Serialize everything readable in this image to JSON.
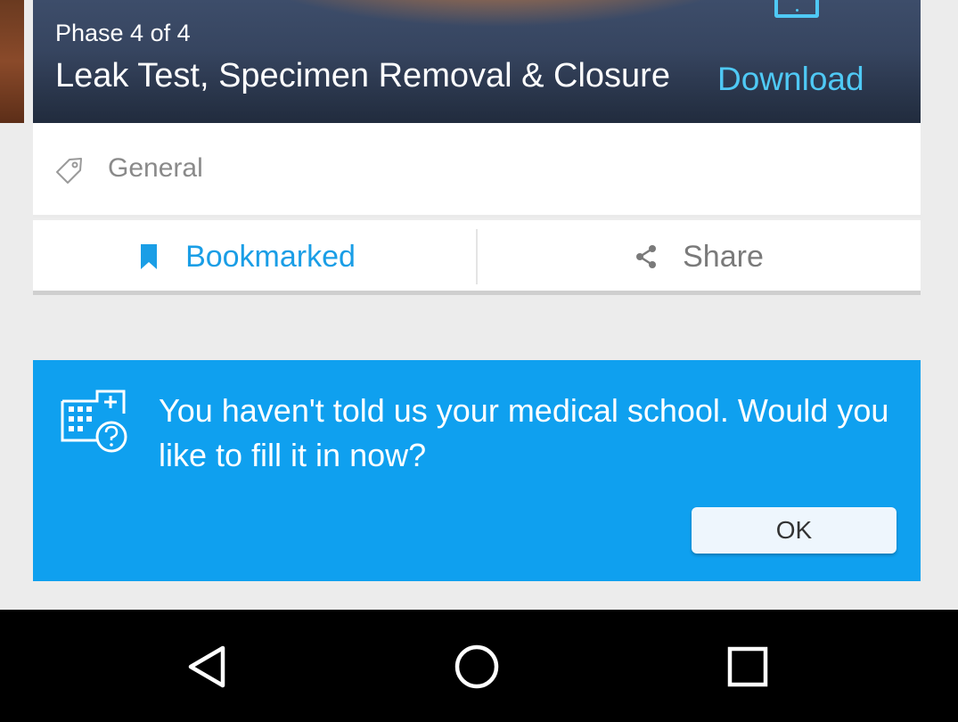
{
  "hero": {
    "phase": "Phase 4 of 4",
    "title": "Leak Test, Specimen Removal & Closure",
    "download_label": "Download",
    "download_icon": "tablet-icon",
    "accent_color": "#4fc9f5"
  },
  "tag": {
    "icon": "tag-icon",
    "label": "General"
  },
  "actions": {
    "bookmark": {
      "icon": "bookmark-icon",
      "label": "Bookmarked",
      "color": "#1a9ee6"
    },
    "share": {
      "icon": "share-icon",
      "label": "Share"
    }
  },
  "banner": {
    "icon": "hospital-question-icon",
    "message": "You haven't told us your medical school. Would you like to fill it in now?",
    "ok_label": "OK",
    "background": "#0fa0ef"
  },
  "nav": {
    "back_icon": "back-triangle-icon",
    "home_icon": "home-circle-icon",
    "recents_icon": "recents-square-icon"
  }
}
